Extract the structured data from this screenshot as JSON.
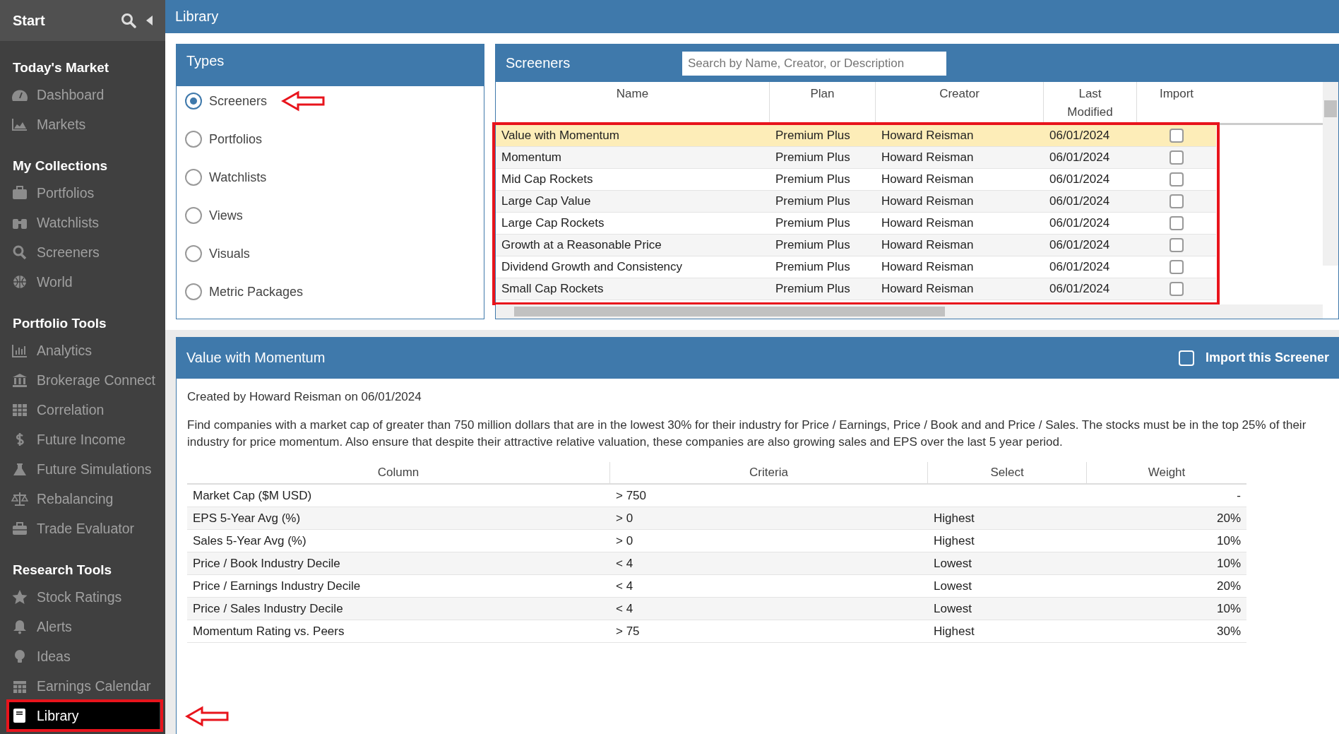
{
  "sidebar": {
    "header": "Start",
    "sections": [
      {
        "title": "Today's Market",
        "items": [
          {
            "label": "Dashboard",
            "selected": false
          },
          {
            "label": "Markets",
            "selected": false
          }
        ]
      },
      {
        "title": "My Collections",
        "items": [
          {
            "label": "Portfolios",
            "selected": false
          },
          {
            "label": "Watchlists",
            "selected": false
          },
          {
            "label": "Screeners",
            "selected": false
          },
          {
            "label": "World",
            "selected": false
          }
        ]
      },
      {
        "title": "Portfolio Tools",
        "items": [
          {
            "label": "Analytics",
            "selected": false
          },
          {
            "label": "Brokerage Connect",
            "selected": false
          },
          {
            "label": "Correlation",
            "selected": false
          },
          {
            "label": "Future Income",
            "selected": false
          },
          {
            "label": "Future Simulations",
            "selected": false
          },
          {
            "label": "Rebalancing",
            "selected": false
          },
          {
            "label": "Trade Evaluator",
            "selected": false
          }
        ]
      },
      {
        "title": "Research Tools",
        "items": [
          {
            "label": "Stock Ratings",
            "selected": false
          },
          {
            "label": "Alerts",
            "selected": false
          },
          {
            "label": "Ideas",
            "selected": false
          },
          {
            "label": "Earnings Calendar",
            "selected": false
          },
          {
            "label": "Library",
            "selected": true
          }
        ]
      }
    ]
  },
  "page_title": "Library",
  "types": {
    "title": "Types",
    "options": [
      {
        "label": "Screeners",
        "selected": true
      },
      {
        "label": "Portfolios",
        "selected": false
      },
      {
        "label": "Watchlists",
        "selected": false
      },
      {
        "label": "Views",
        "selected": false
      },
      {
        "label": "Visuals",
        "selected": false
      },
      {
        "label": "Metric Packages",
        "selected": false
      }
    ]
  },
  "screeners": {
    "title": "Screeners",
    "search": {
      "placeholder": "Search by Name, Creator, or Description"
    },
    "columns": [
      "Name",
      "Plan",
      "Creator",
      "Last Modified",
      "Import"
    ],
    "rows": [
      {
        "name": "Value with Momentum",
        "plan": "Premium Plus",
        "creator": "Howard Reisman",
        "modified": "06/01/2024",
        "import": false,
        "selected": true
      },
      {
        "name": "Momentum",
        "plan": "Premium Plus",
        "creator": "Howard Reisman",
        "modified": "06/01/2024",
        "import": false,
        "selected": false
      },
      {
        "name": "Mid Cap Rockets",
        "plan": "Premium Plus",
        "creator": "Howard Reisman",
        "modified": "06/01/2024",
        "import": false,
        "selected": false
      },
      {
        "name": "Large Cap Value",
        "plan": "Premium Plus",
        "creator": "Howard Reisman",
        "modified": "06/01/2024",
        "import": false,
        "selected": false
      },
      {
        "name": "Large Cap Rockets",
        "plan": "Premium Plus",
        "creator": "Howard Reisman",
        "modified": "06/01/2024",
        "import": false,
        "selected": false
      },
      {
        "name": "Growth at a Reasonable Price",
        "plan": "Premium Plus",
        "creator": "Howard Reisman",
        "modified": "06/01/2024",
        "import": false,
        "selected": false
      },
      {
        "name": "Dividend Growth and Consistency",
        "plan": "Premium Plus",
        "creator": "Howard Reisman",
        "modified": "06/01/2024",
        "import": false,
        "selected": false
      },
      {
        "name": "Small Cap Rockets",
        "plan": "Premium Plus",
        "creator": "Howard Reisman",
        "modified": "06/01/2024",
        "import": false,
        "selected": false
      }
    ]
  },
  "detail": {
    "title": "Value with Momentum",
    "import_label": "Import this Screener",
    "import_checked": false,
    "created": "Created by Howard Reisman on 06/01/2024",
    "description": "Find companies with a market cap of greater than 750 million dollars that are in the lowest 30% for their industry for Price / Earnings, Price / Book and and Price / Sales. The stocks must be in the top 25% of their industry for price momentum. Also ensure that despite their attractive relative valuation, these companies are also growing sales and EPS over the last 5 year period.",
    "columns": [
      "Column",
      "Criteria",
      "Select",
      "Weight"
    ],
    "rows": [
      {
        "column": "Market Cap ($M USD)",
        "criteria": "> 750",
        "select": "",
        "weight": "-"
      },
      {
        "column": "EPS 5-Year Avg (%)",
        "criteria": "> 0",
        "select": "Highest",
        "weight": "20%"
      },
      {
        "column": "Sales 5-Year Avg (%)",
        "criteria": "> 0",
        "select": "Highest",
        "weight": "10%"
      },
      {
        "column": "Price / Book Industry Decile",
        "criteria": "< 4",
        "select": "Lowest",
        "weight": "10%"
      },
      {
        "column": "Price / Earnings Industry Decile",
        "criteria": "< 4",
        "select": "Lowest",
        "weight": "20%"
      },
      {
        "column": "Price / Sales Industry Decile",
        "criteria": "< 4",
        "select": "Lowest",
        "weight": "10%"
      },
      {
        "column": "Momentum Rating vs. Peers",
        "criteria": "> 75",
        "select": "Highest",
        "weight": "30%"
      }
    ]
  }
}
